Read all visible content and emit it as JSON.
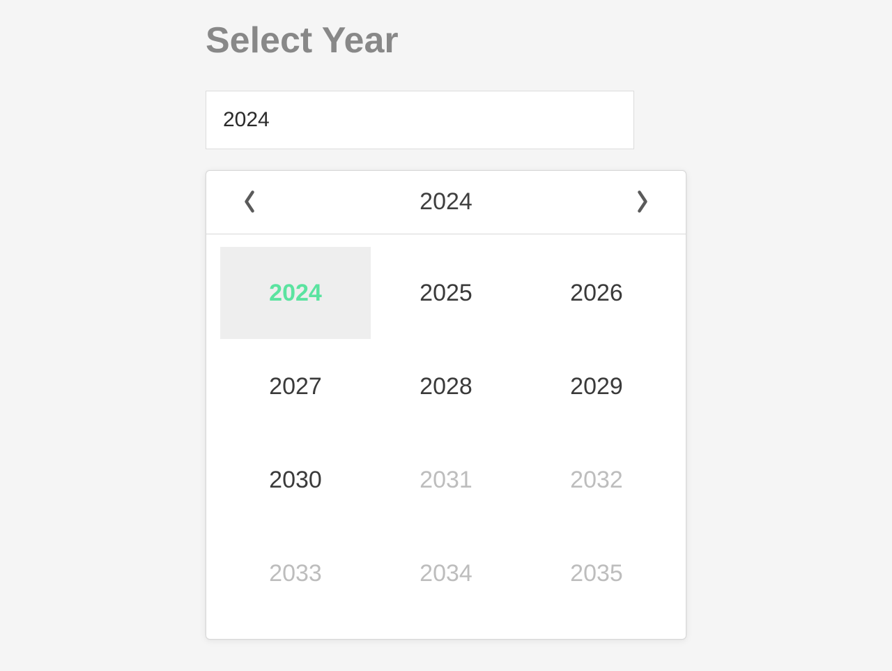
{
  "title": "Select Year",
  "input": {
    "value": "2024"
  },
  "picker": {
    "header_year": "2024",
    "years": [
      {
        "label": "2024",
        "selected": true,
        "disabled": false
      },
      {
        "label": "2025",
        "selected": false,
        "disabled": false
      },
      {
        "label": "2026",
        "selected": false,
        "disabled": false
      },
      {
        "label": "2027",
        "selected": false,
        "disabled": false
      },
      {
        "label": "2028",
        "selected": false,
        "disabled": false
      },
      {
        "label": "2029",
        "selected": false,
        "disabled": false
      },
      {
        "label": "2030",
        "selected": false,
        "disabled": false
      },
      {
        "label": "2031",
        "selected": false,
        "disabled": true
      },
      {
        "label": "2032",
        "selected": false,
        "disabled": true
      },
      {
        "label": "2033",
        "selected": false,
        "disabled": true
      },
      {
        "label": "2034",
        "selected": false,
        "disabled": true
      },
      {
        "label": "2035",
        "selected": false,
        "disabled": true
      }
    ]
  }
}
